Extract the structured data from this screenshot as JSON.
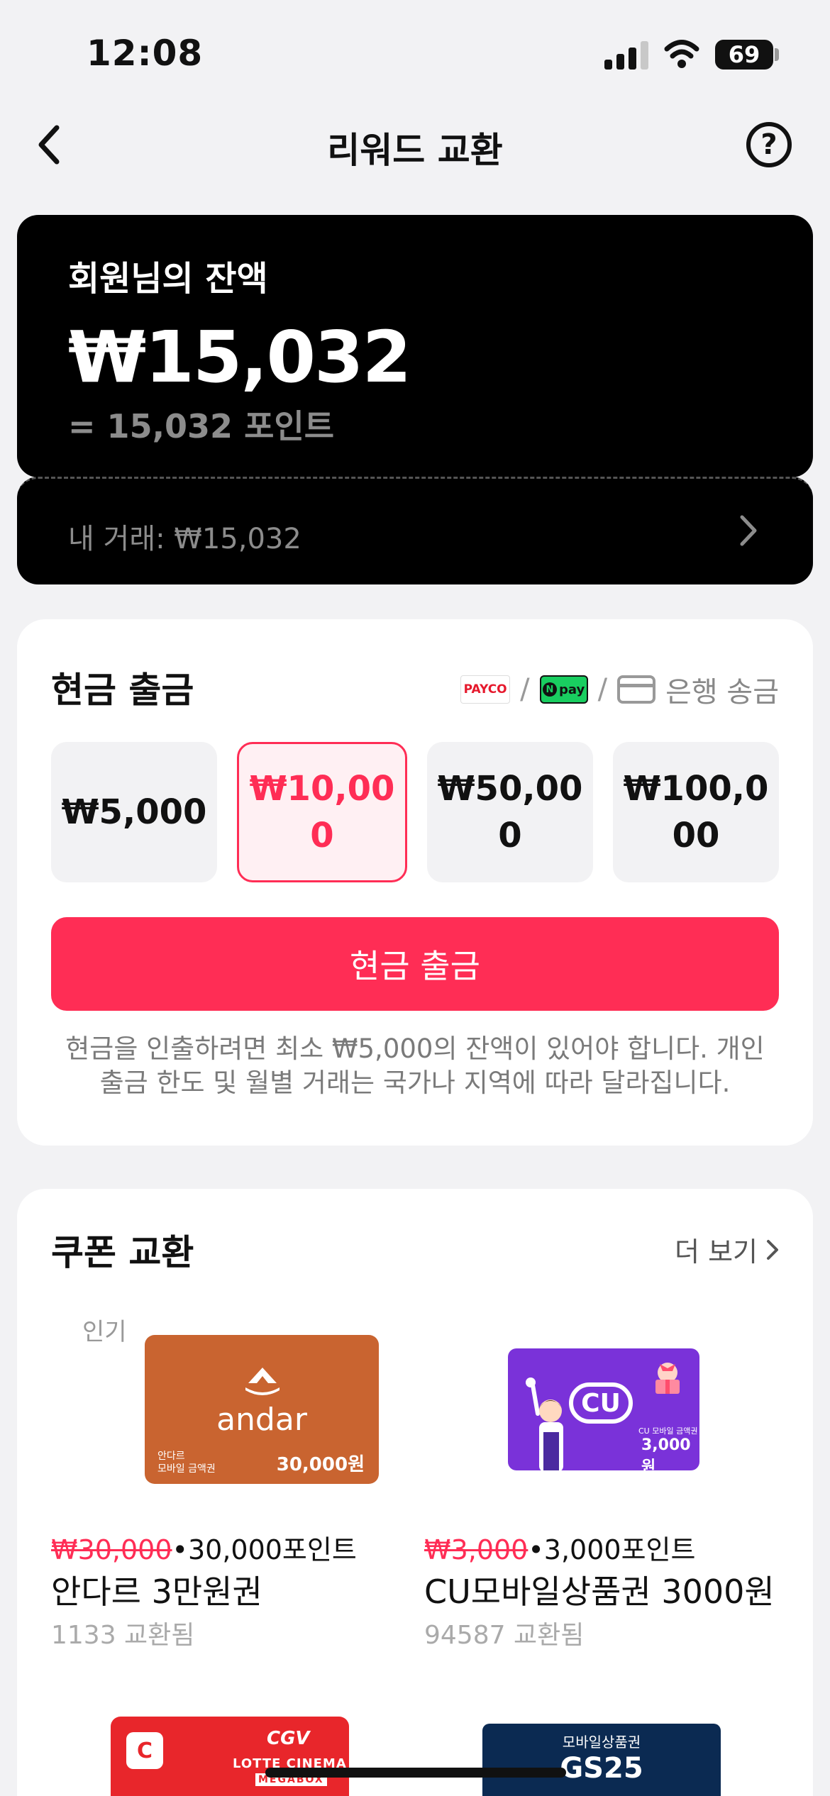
{
  "status_bar": {
    "time": "12:08",
    "battery": "69"
  },
  "nav": {
    "title": "리워드 교환",
    "help_label": "?"
  },
  "balance": {
    "label": "회원님의 잔액",
    "amount": "₩15,032",
    "points": "= 15,032 포인트",
    "transactions": "내 거래: ₩15,032"
  },
  "cash": {
    "title": "현금 출금",
    "methods": {
      "payco": "PAYCO",
      "npay": "pay",
      "npay_n": "N",
      "separator": "/",
      "bank": "은행 송금"
    },
    "amounts": [
      {
        "label": "₩5,000",
        "selected": false
      },
      {
        "label": "₩10,000",
        "selected": true
      },
      {
        "label": "₩50,000",
        "selected": false
      },
      {
        "label": "₩100,000",
        "selected": false
      }
    ],
    "button": "현금 출금",
    "note": "현금을 인출하려면 최소 ₩5,000의 잔액이 있어야 합니다. 개인 출금 한도 및 월별 거래는 국가나 지역에 따라 달라집니다."
  },
  "coupons": {
    "title": "쿠폰 교환",
    "more": "더 보기",
    "items": [
      {
        "badge": "인기",
        "brand": "andar",
        "card_small": "안다르\n모바일 금액권",
        "card_price": "30,000원",
        "original_price": "₩30,000",
        "dot": "•",
        "points": "30,000포인트",
        "name": "안다르 3만원권",
        "count": "1133 교환됨"
      },
      {
        "brand": "CU",
        "card_small": "CU 모바일 금액권",
        "card_price": "3,000원",
        "original_price": "₩3,000",
        "dot": "•",
        "points": "3,000포인트",
        "name": "CU모바일상품권 3000원",
        "count": "94587 교환됨"
      },
      {
        "brand_mark": "C",
        "brand_cgv": "CGV",
        "brand_lotte": "LOTTE CINEMA",
        "brand_mega": "MEGABOX"
      },
      {
        "label": "모바일상품권",
        "brand": "GS25"
      }
    ]
  },
  "colors": {
    "accent": "#ff2d55",
    "card_bg": "#000000",
    "page_bg": "#f2f2f4"
  }
}
